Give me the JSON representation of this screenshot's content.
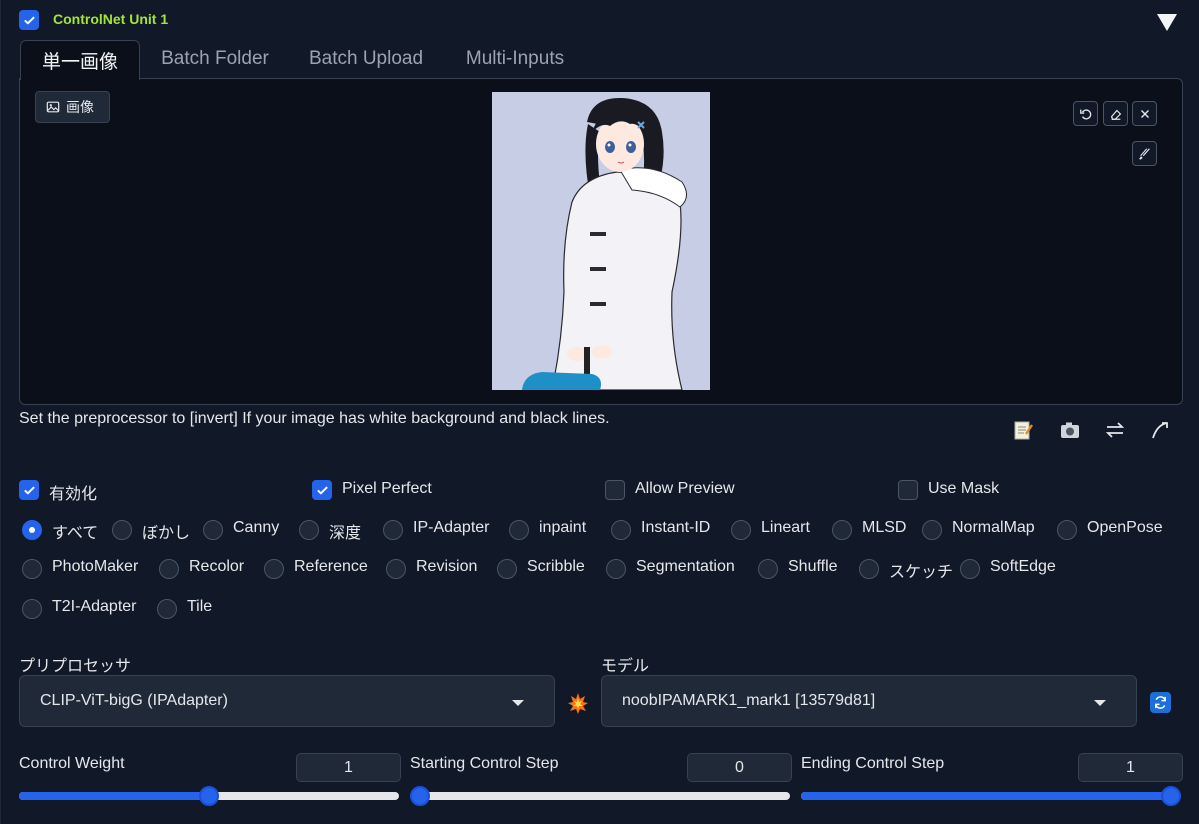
{
  "unit": {
    "title": "ControlNet Unit 1",
    "enabled": true
  },
  "tabs": [
    {
      "label": "単一画像",
      "active": true
    },
    {
      "label": "Batch Folder",
      "active": false
    },
    {
      "label": "Batch Upload",
      "active": false
    },
    {
      "label": "Multi-Inputs",
      "active": false
    }
  ],
  "image_panel": {
    "label": "画像",
    "buttons": [
      "undo-icon",
      "eraser-icon",
      "close-icon",
      "brush-icon"
    ]
  },
  "hint": "Set the preprocessor to [invert] If your image has white background and black lines.",
  "tools": [
    "memo-icon",
    "camera-icon",
    "swap-icon",
    "send-icon"
  ],
  "options": [
    {
      "label": "有効化",
      "checked": true
    },
    {
      "label": "Pixel Perfect",
      "checked": true
    },
    {
      "label": "Allow Preview",
      "checked": false
    },
    {
      "label": "Use Mask",
      "checked": false
    }
  ],
  "control_types": {
    "selected": "すべて",
    "items": [
      "すべて",
      "ぼかし",
      "Canny",
      "深度",
      "IP-Adapter",
      "inpaint",
      "Instant-ID",
      "Lineart",
      "MLSD",
      "NormalMap",
      "OpenPose",
      "PhotoMaker",
      "Recolor",
      "Reference",
      "Revision",
      "Scribble",
      "Segmentation",
      "Shuffle",
      "スケッチ",
      "SoftEdge",
      "T2I-Adapter",
      "Tile"
    ]
  },
  "preprocessor": {
    "label": "プリプロセッサ",
    "value": "CLIP-ViT-bigG (IPAdapter)",
    "run_icon": "explosion-icon"
  },
  "model": {
    "label": "モデル",
    "value": "noobIPAMARK1_mark1 [13579d81]",
    "refresh_icon": "refresh-icon"
  },
  "sliders": [
    {
      "label": "Control Weight",
      "value": "1",
      "fraction": 0.5
    },
    {
      "label": "Starting Control Step",
      "value": "0",
      "fraction": 0.0
    },
    {
      "label": "Ending Control Step",
      "value": "1",
      "fraction": 1.0
    }
  ],
  "colors": {
    "accent": "#2563eb",
    "title": "#a3e635",
    "background": "#111827"
  }
}
